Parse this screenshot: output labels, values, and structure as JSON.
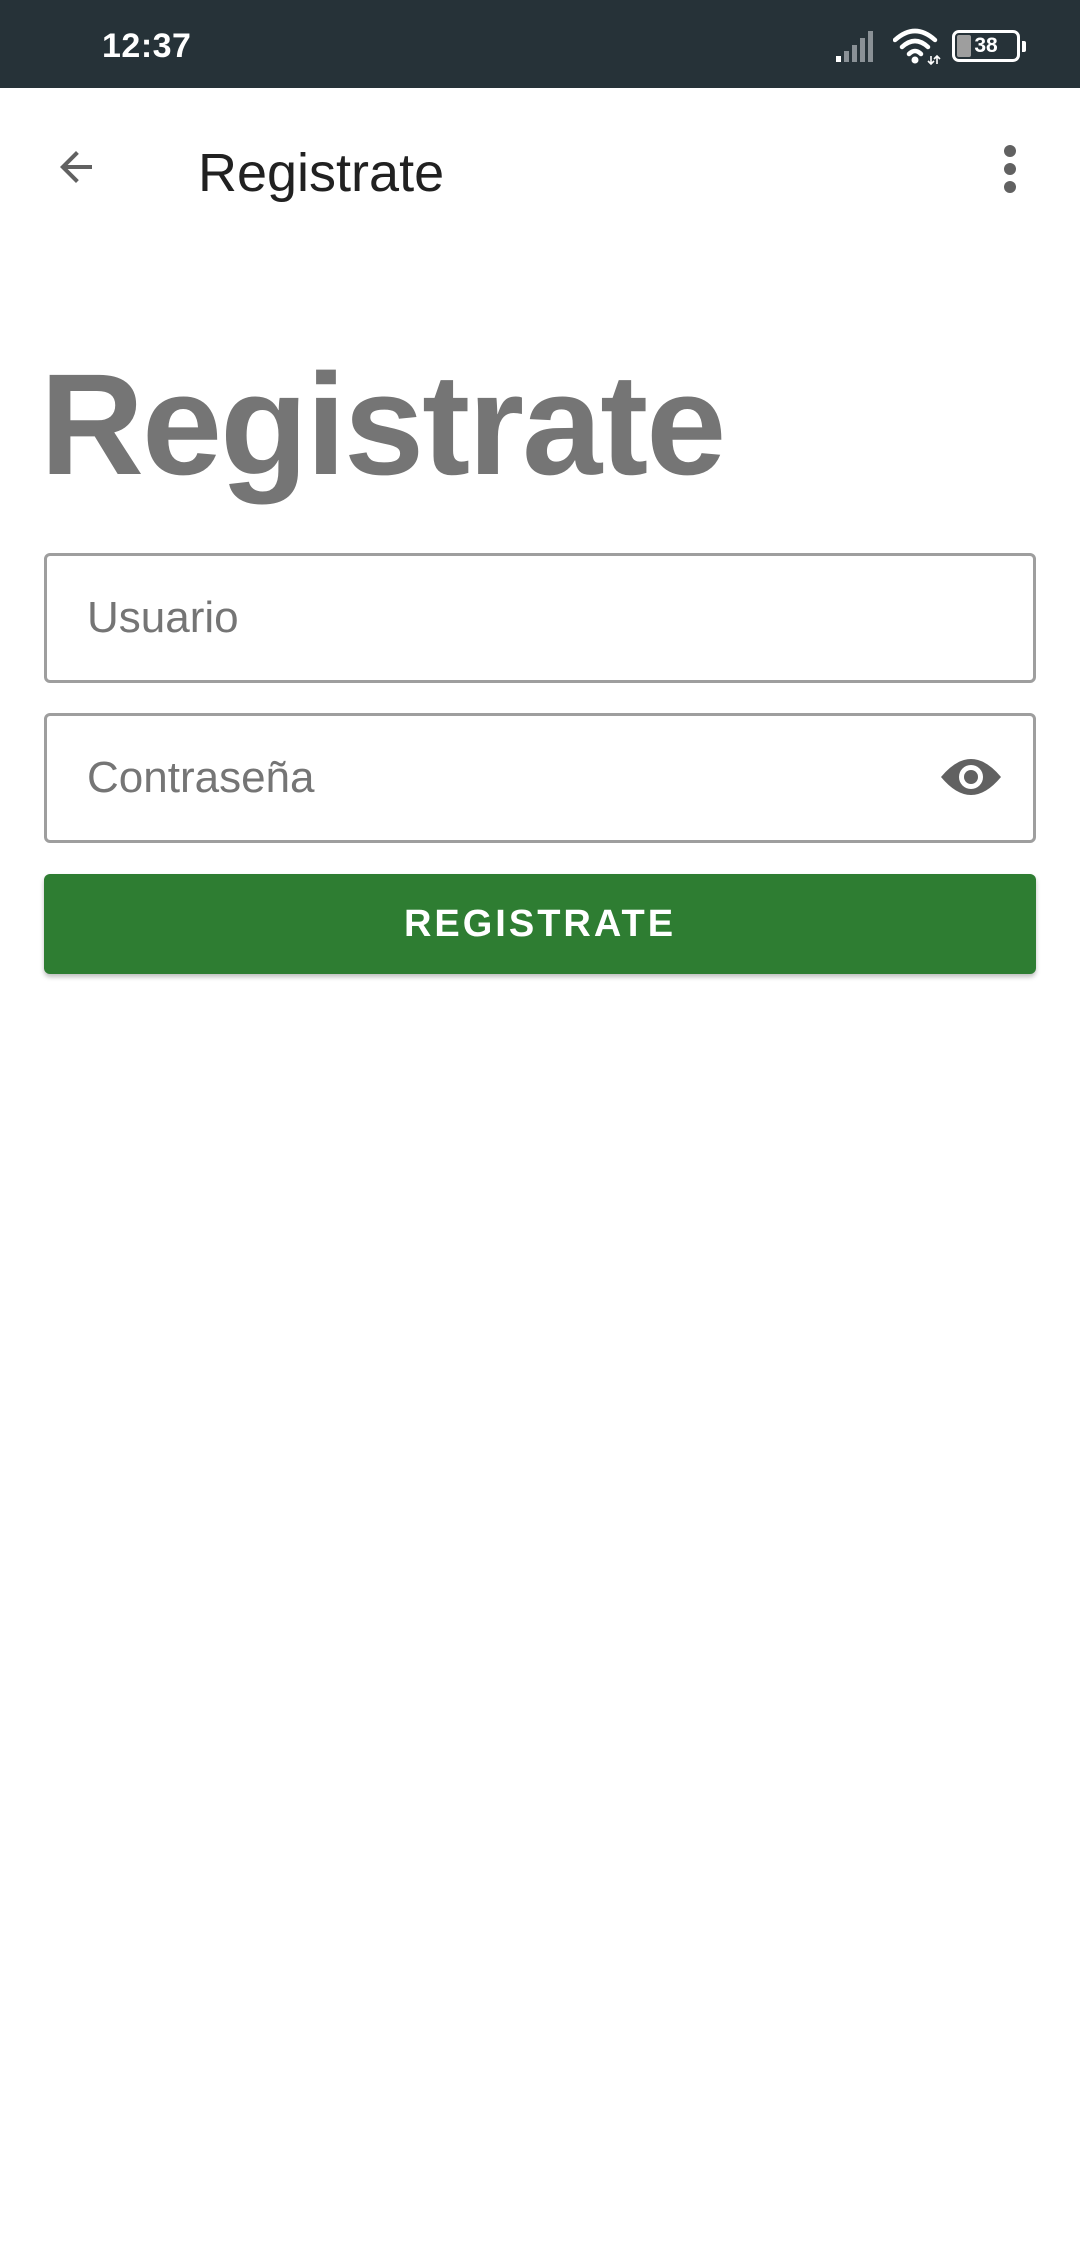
{
  "status_bar": {
    "time": "12:37",
    "battery": "38",
    "icons": [
      "signal-icon",
      "wifi-icon",
      "battery-icon"
    ]
  },
  "app_bar": {
    "title": "Registrate",
    "back_icon": "arrow-back-icon",
    "menu_icon": "more-vert-icon"
  },
  "form": {
    "heading": "Registrate",
    "username": {
      "placeholder": "Usuario",
      "value": ""
    },
    "password": {
      "placeholder": "Contraseña",
      "value": "",
      "toggle_icon": "eye-icon"
    },
    "submit_label": "REGISTRATE"
  },
  "colors": {
    "status_bar": "#263238",
    "primary": "#2e7d32",
    "heading": "#757575",
    "field_border": "#9e9e9e"
  }
}
